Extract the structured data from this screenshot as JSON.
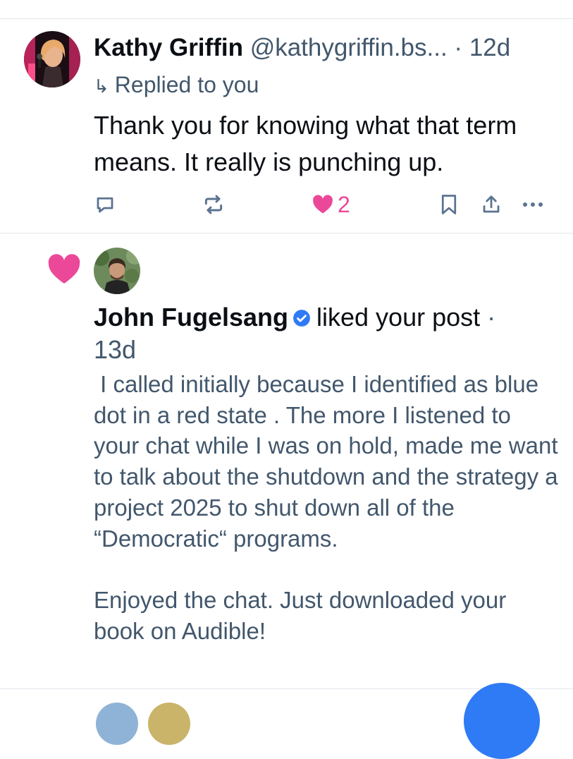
{
  "reply": {
    "author_name": "Kathy Griffin",
    "author_handle": "@kathygriffin.bs...",
    "time": "12d",
    "replied_label": "Replied to you",
    "text": "Thank you for knowing what that term means. It really is punching up.",
    "like_count": "2"
  },
  "notification": {
    "liker_name": "John Fugelsang",
    "action_text": "liked your post",
    "time": "13d",
    "post_text": " I called initially because I identified as blue dot in a red state . The more I listened to your chat while I was on hold, made me want to talk about the shutdown and the strategy a project 2025 to shut down all of the “Democratic“ programs.\n\nEnjoyed the chat. Just downloaded your book on Audible!"
  },
  "icons": {
    "reply": "comment-icon",
    "repost": "repost-icon",
    "like": "heart-icon",
    "bookmark": "bookmark-icon",
    "share": "share-icon",
    "more": "more-icon",
    "verified": "verified-badge-icon",
    "replied_arrow": "reply-arrow-icon"
  },
  "colors": {
    "accent": "#2f7bf5",
    "like": "#ec4899",
    "muted_text": "#42576c",
    "icon": "#5a7390"
  }
}
